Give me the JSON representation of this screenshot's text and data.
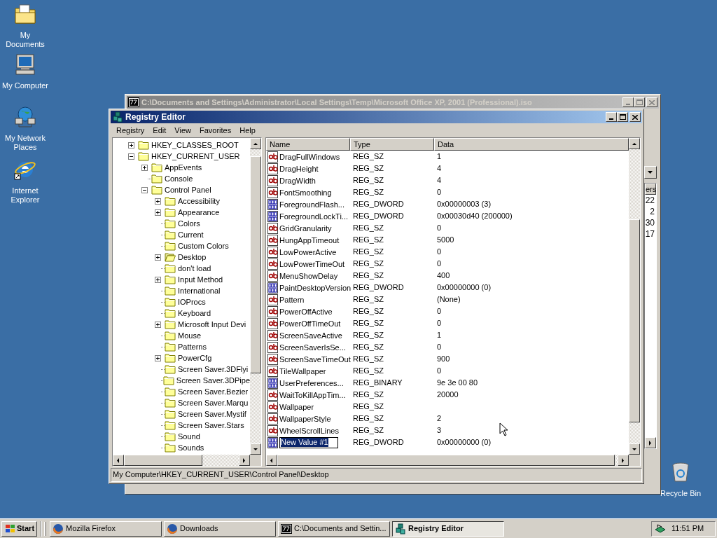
{
  "desktop_icons": [
    {
      "label": "My Documents",
      "kind": "documents"
    },
    {
      "label": "My Computer",
      "kind": "computer"
    },
    {
      "label": "My Network Places",
      "kind": "network"
    },
    {
      "label": "Internet Explorer",
      "kind": "browser"
    },
    {
      "label": "Recycle Bin",
      "kind": "recycle"
    }
  ],
  "background_window": {
    "title": "C:\\Documents and Settings\\Administrator\\Local Settings\\Temp\\Microsoft Office XP, 2001 (Professional).iso",
    "column_header": "ers",
    "cells": [
      "22",
      "2",
      "30",
      "17"
    ]
  },
  "registry_editor": {
    "title": "Registry Editor",
    "menu": [
      "Registry",
      "Edit",
      "View",
      "Favorites",
      "Help"
    ],
    "tree": [
      {
        "label": "HKEY_CLASSES_ROOT",
        "kind": "collapsed",
        "selected": false
      },
      {
        "label": "HKEY_CURRENT_USER",
        "kind": "expanded",
        "selected": false,
        "children": [
          {
            "label": "AppEvents",
            "kind": "collapsed",
            "selected": false
          },
          {
            "label": "Console",
            "kind": "leaf",
            "selected": false
          },
          {
            "label": "Control Panel",
            "kind": "expanded",
            "selected": false,
            "children": [
              {
                "label": "Accessibility",
                "kind": "collapsed",
                "selected": false
              },
              {
                "label": "Appearance",
                "kind": "collapsed",
                "selected": false
              },
              {
                "label": "Colors",
                "kind": "leaf",
                "selected": false
              },
              {
                "label": "Current",
                "kind": "leaf",
                "selected": false
              },
              {
                "label": "Custom Colors",
                "kind": "leaf",
                "selected": false
              },
              {
                "label": "Desktop",
                "kind": "collapsed",
                "selected": true
              },
              {
                "label": "don't load",
                "kind": "leaf",
                "selected": false
              },
              {
                "label": "Input Method",
                "kind": "collapsed",
                "selected": false
              },
              {
                "label": "International",
                "kind": "leaf",
                "selected": false
              },
              {
                "label": "IOProcs",
                "kind": "leaf",
                "selected": false
              },
              {
                "label": "Keyboard",
                "kind": "leaf",
                "selected": false
              },
              {
                "label": "Microsoft Input Devi",
                "kind": "collapsed",
                "selected": false
              },
              {
                "label": "Mouse",
                "kind": "leaf",
                "selected": false
              },
              {
                "label": "Patterns",
                "kind": "leaf",
                "selected": false
              },
              {
                "label": "PowerCfg",
                "kind": "collapsed",
                "selected": false
              },
              {
                "label": "Screen Saver.3DFlyi",
                "kind": "leaf",
                "selected": false
              },
              {
                "label": "Screen Saver.3DPipe",
                "kind": "leaf",
                "selected": false
              },
              {
                "label": "Screen Saver.Bezier",
                "kind": "leaf",
                "selected": false
              },
              {
                "label": "Screen Saver.Marqu",
                "kind": "leaf",
                "selected": false
              },
              {
                "label": "Screen Saver.Mystif",
                "kind": "leaf",
                "selected": false
              },
              {
                "label": "Screen Saver.Stars",
                "kind": "leaf",
                "selected": false
              },
              {
                "label": "Sound",
                "kind": "leaf",
                "selected": false
              },
              {
                "label": "Sounds",
                "kind": "leaf",
                "selected": false
              }
            ]
          }
        ]
      }
    ],
    "list": {
      "columns": [
        "Name",
        "Type",
        "Data"
      ],
      "rows": [
        {
          "name": "DragFullWindows",
          "type": "REG_SZ",
          "data": "1",
          "kind": "string",
          "editing": false
        },
        {
          "name": "DragHeight",
          "type": "REG_SZ",
          "data": "4",
          "kind": "string",
          "editing": false
        },
        {
          "name": "DragWidth",
          "type": "REG_SZ",
          "data": "4",
          "kind": "string",
          "editing": false
        },
        {
          "name": "FontSmoothing",
          "type": "REG_SZ",
          "data": "0",
          "kind": "string",
          "editing": false
        },
        {
          "name": "ForegroundFlash...",
          "type": "REG_DWORD",
          "data": "0x00000003 (3)",
          "kind": "binary",
          "editing": false
        },
        {
          "name": "ForegroundLockTi...",
          "type": "REG_DWORD",
          "data": "0x00030d40 (200000)",
          "kind": "binary",
          "editing": false
        },
        {
          "name": "GridGranularity",
          "type": "REG_SZ",
          "data": "0",
          "kind": "string",
          "editing": false
        },
        {
          "name": "HungAppTimeout",
          "type": "REG_SZ",
          "data": "5000",
          "kind": "string",
          "editing": false
        },
        {
          "name": "LowPowerActive",
          "type": "REG_SZ",
          "data": "0",
          "kind": "string",
          "editing": false
        },
        {
          "name": "LowPowerTimeOut",
          "type": "REG_SZ",
          "data": "0",
          "kind": "string",
          "editing": false
        },
        {
          "name": "MenuShowDelay",
          "type": "REG_SZ",
          "data": "400",
          "kind": "string",
          "editing": false
        },
        {
          "name": "PaintDesktopVersion",
          "type": "REG_DWORD",
          "data": "0x00000000 (0)",
          "kind": "binary",
          "editing": false
        },
        {
          "name": "Pattern",
          "type": "REG_SZ",
          "data": "(None)",
          "kind": "string",
          "editing": false
        },
        {
          "name": "PowerOffActive",
          "type": "REG_SZ",
          "data": "0",
          "kind": "string",
          "editing": false
        },
        {
          "name": "PowerOffTimeOut",
          "type": "REG_SZ",
          "data": "0",
          "kind": "string",
          "editing": false
        },
        {
          "name": "ScreenSaveActive",
          "type": "REG_SZ",
          "data": "1",
          "kind": "string",
          "editing": false
        },
        {
          "name": "ScreenSaverIsSe...",
          "type": "REG_SZ",
          "data": "0",
          "kind": "string",
          "editing": false
        },
        {
          "name": "ScreenSaveTimeOut",
          "type": "REG_SZ",
          "data": "900",
          "kind": "string",
          "editing": false
        },
        {
          "name": "TileWallpaper",
          "type": "REG_SZ",
          "data": "0",
          "kind": "string",
          "editing": false
        },
        {
          "name": "UserPreferences...",
          "type": "REG_BINARY",
          "data": "9e 3e 00 80",
          "kind": "binary",
          "editing": false
        },
        {
          "name": "WaitToKillAppTim...",
          "type": "REG_SZ",
          "data": "20000",
          "kind": "string",
          "editing": false
        },
        {
          "name": "Wallpaper",
          "type": "REG_SZ",
          "kind": "string",
          "editing": false
        },
        {
          "name": "WallpaperStyle",
          "type": "REG_SZ",
          "data": "2",
          "kind": "string",
          "editing": false
        },
        {
          "name": "WheelScrollLines",
          "type": "REG_SZ",
          "data": "3",
          "kind": "string",
          "editing": false
        },
        {
          "name": "New Value #1",
          "type": "REG_DWORD",
          "data": "0x00000000 (0)",
          "kind": "binary",
          "editing": true
        }
      ]
    },
    "status_bar": "My Computer\\HKEY_CURRENT_USER\\Control Panel\\Desktop"
  },
  "taskbar": {
    "start": "Start",
    "buttons": [
      {
        "label": "Mozilla Firefox",
        "kind": "firefox",
        "selected": false
      },
      {
        "label": "Downloads",
        "kind": "firefox",
        "selected": false
      },
      {
        "label": "C:\\Documents and Settin...",
        "kind": "archive",
        "selected": false
      },
      {
        "label": "Registry Editor",
        "kind": "regedit",
        "selected": true
      }
    ],
    "clock": "11:51 PM"
  }
}
